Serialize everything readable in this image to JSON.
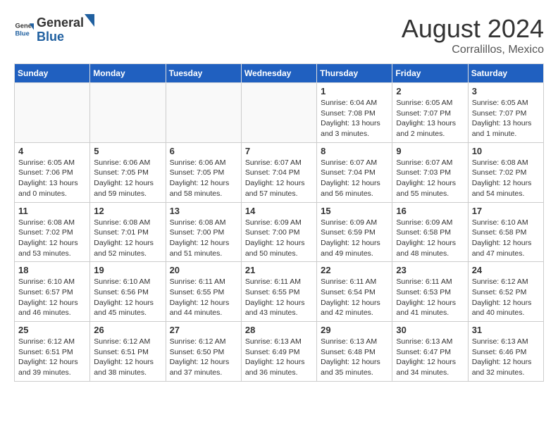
{
  "header": {
    "logo_general": "General",
    "logo_blue": "Blue",
    "month_year": "August 2024",
    "location": "Corralillos, Mexico"
  },
  "days_of_week": [
    "Sunday",
    "Monday",
    "Tuesday",
    "Wednesday",
    "Thursday",
    "Friday",
    "Saturday"
  ],
  "weeks": [
    [
      {
        "day": "",
        "empty": true
      },
      {
        "day": "",
        "empty": true
      },
      {
        "day": "",
        "empty": true
      },
      {
        "day": "",
        "empty": true
      },
      {
        "day": "1",
        "sunrise": "6:04 AM",
        "sunset": "7:08 PM",
        "daylight": "13 hours and 3 minutes."
      },
      {
        "day": "2",
        "sunrise": "6:05 AM",
        "sunset": "7:07 PM",
        "daylight": "13 hours and 2 minutes."
      },
      {
        "day": "3",
        "sunrise": "6:05 AM",
        "sunset": "7:07 PM",
        "daylight": "13 hours and 1 minute."
      }
    ],
    [
      {
        "day": "4",
        "sunrise": "6:05 AM",
        "sunset": "7:06 PM",
        "daylight": "13 hours and 0 minutes."
      },
      {
        "day": "5",
        "sunrise": "6:06 AM",
        "sunset": "7:05 PM",
        "daylight": "12 hours and 59 minutes."
      },
      {
        "day": "6",
        "sunrise": "6:06 AM",
        "sunset": "7:05 PM",
        "daylight": "12 hours and 58 minutes."
      },
      {
        "day": "7",
        "sunrise": "6:07 AM",
        "sunset": "7:04 PM",
        "daylight": "12 hours and 57 minutes."
      },
      {
        "day": "8",
        "sunrise": "6:07 AM",
        "sunset": "7:04 PM",
        "daylight": "12 hours and 56 minutes."
      },
      {
        "day": "9",
        "sunrise": "6:07 AM",
        "sunset": "7:03 PM",
        "daylight": "12 hours and 55 minutes."
      },
      {
        "day": "10",
        "sunrise": "6:08 AM",
        "sunset": "7:02 PM",
        "daylight": "12 hours and 54 minutes."
      }
    ],
    [
      {
        "day": "11",
        "sunrise": "6:08 AM",
        "sunset": "7:02 PM",
        "daylight": "12 hours and 53 minutes."
      },
      {
        "day": "12",
        "sunrise": "6:08 AM",
        "sunset": "7:01 PM",
        "daylight": "12 hours and 52 minutes."
      },
      {
        "day": "13",
        "sunrise": "6:08 AM",
        "sunset": "7:00 PM",
        "daylight": "12 hours and 51 minutes."
      },
      {
        "day": "14",
        "sunrise": "6:09 AM",
        "sunset": "7:00 PM",
        "daylight": "12 hours and 50 minutes."
      },
      {
        "day": "15",
        "sunrise": "6:09 AM",
        "sunset": "6:59 PM",
        "daylight": "12 hours and 49 minutes."
      },
      {
        "day": "16",
        "sunrise": "6:09 AM",
        "sunset": "6:58 PM",
        "daylight": "12 hours and 48 minutes."
      },
      {
        "day": "17",
        "sunrise": "6:10 AM",
        "sunset": "6:58 PM",
        "daylight": "12 hours and 47 minutes."
      }
    ],
    [
      {
        "day": "18",
        "sunrise": "6:10 AM",
        "sunset": "6:57 PM",
        "daylight": "12 hours and 46 minutes."
      },
      {
        "day": "19",
        "sunrise": "6:10 AM",
        "sunset": "6:56 PM",
        "daylight": "12 hours and 45 minutes."
      },
      {
        "day": "20",
        "sunrise": "6:11 AM",
        "sunset": "6:55 PM",
        "daylight": "12 hours and 44 minutes."
      },
      {
        "day": "21",
        "sunrise": "6:11 AM",
        "sunset": "6:55 PM",
        "daylight": "12 hours and 43 minutes."
      },
      {
        "day": "22",
        "sunrise": "6:11 AM",
        "sunset": "6:54 PM",
        "daylight": "12 hours and 42 minutes."
      },
      {
        "day": "23",
        "sunrise": "6:11 AM",
        "sunset": "6:53 PM",
        "daylight": "12 hours and 41 minutes."
      },
      {
        "day": "24",
        "sunrise": "6:12 AM",
        "sunset": "6:52 PM",
        "daylight": "12 hours and 40 minutes."
      }
    ],
    [
      {
        "day": "25",
        "sunrise": "6:12 AM",
        "sunset": "6:51 PM",
        "daylight": "12 hours and 39 minutes."
      },
      {
        "day": "26",
        "sunrise": "6:12 AM",
        "sunset": "6:51 PM",
        "daylight": "12 hours and 38 minutes."
      },
      {
        "day": "27",
        "sunrise": "6:12 AM",
        "sunset": "6:50 PM",
        "daylight": "12 hours and 37 minutes."
      },
      {
        "day": "28",
        "sunrise": "6:13 AM",
        "sunset": "6:49 PM",
        "daylight": "12 hours and 36 minutes."
      },
      {
        "day": "29",
        "sunrise": "6:13 AM",
        "sunset": "6:48 PM",
        "daylight": "12 hours and 35 minutes."
      },
      {
        "day": "30",
        "sunrise": "6:13 AM",
        "sunset": "6:47 PM",
        "daylight": "12 hours and 34 minutes."
      },
      {
        "day": "31",
        "sunrise": "6:13 AM",
        "sunset": "6:46 PM",
        "daylight": "12 hours and 32 minutes."
      }
    ]
  ],
  "labels": {
    "sunrise": "Sunrise:",
    "sunset": "Sunset:",
    "daylight": "Daylight:"
  }
}
